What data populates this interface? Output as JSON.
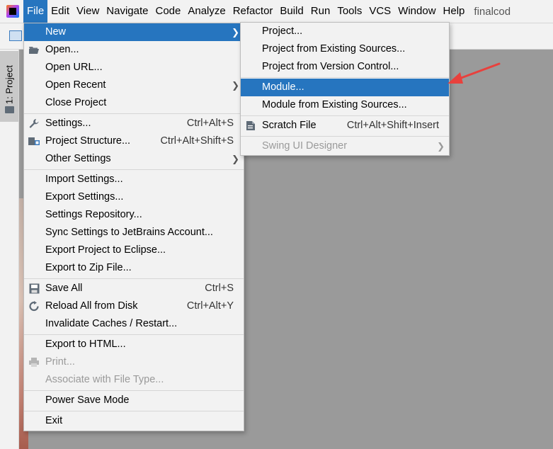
{
  "menubar": {
    "items": [
      "File",
      "Edit",
      "View",
      "Navigate",
      "Code",
      "Analyze",
      "Refactor",
      "Build",
      "Run",
      "Tools",
      "VCS",
      "Window",
      "Help"
    ],
    "project_title": "finalcod"
  },
  "toolstrip": {
    "project_tab_label": "1: Project"
  },
  "file_menu": {
    "new": "New",
    "open": "Open...",
    "open_url": "Open URL...",
    "open_recent": "Open Recent",
    "close_project": "Close Project",
    "settings": "Settings...",
    "settings_sc": "Ctrl+Alt+S",
    "project_structure": "Project Structure...",
    "project_structure_sc": "Ctrl+Alt+Shift+S",
    "other_settings": "Other Settings",
    "import_settings": "Import Settings...",
    "export_settings": "Export Settings...",
    "settings_repository": "Settings Repository...",
    "sync_settings": "Sync Settings to JetBrains Account...",
    "export_eclipse": "Export Project to Eclipse...",
    "export_zip": "Export to Zip File...",
    "save_all": "Save All",
    "save_all_sc": "Ctrl+S",
    "reload_all": "Reload All from Disk",
    "reload_all_sc": "Ctrl+Alt+Y",
    "invalidate_caches": "Invalidate Caches / Restart...",
    "export_html": "Export to HTML...",
    "print": "Print...",
    "associate": "Associate with File Type...",
    "power_save": "Power Save Mode",
    "exit": "Exit"
  },
  "new_submenu": {
    "project": "Project...",
    "project_existing": "Project from Existing Sources...",
    "project_vcs": "Project from Version Control...",
    "module": "Module...",
    "module_existing": "Module from Existing Sources...",
    "scratch_file": "Scratch File",
    "scratch_file_sc": "Ctrl+Alt+Shift+Insert",
    "swing_designer": "Swing UI Designer"
  },
  "colors": {
    "selection": "#2675bf",
    "annotation_arrow": "#e8413d"
  }
}
